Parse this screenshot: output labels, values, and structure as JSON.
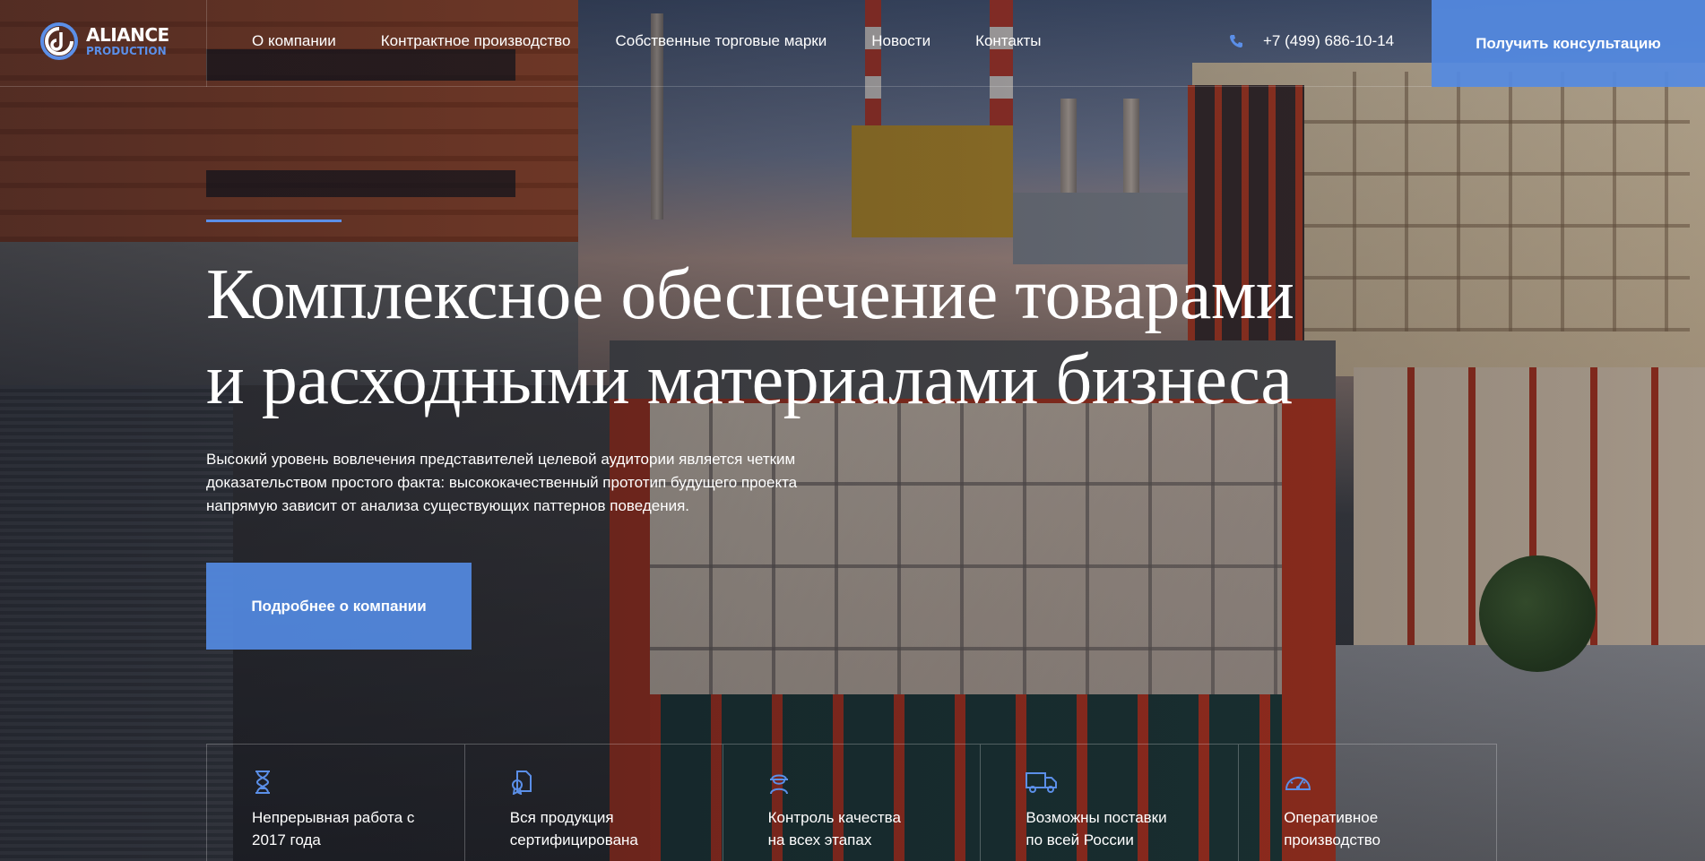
{
  "brand": {
    "name": "ALIANCE",
    "sub": "PRODUCTION",
    "accent_color": "#5b8fe8"
  },
  "nav": {
    "items": [
      {
        "label": "О компании"
      },
      {
        "label": "Контрактное производство"
      },
      {
        "label": "Собственные торговые марки"
      },
      {
        "label": "Новости"
      },
      {
        "label": "Контакты"
      }
    ]
  },
  "header": {
    "phone": "+7 (499) 686-10-14",
    "phone_icon": "phone-icon",
    "cta_label": "Получить консультацию"
  },
  "hero": {
    "title_lines": [
      "Комплексное обеспечение товарами",
      "и расходными материалами бизнеса"
    ],
    "description_lines": [
      "Высокий уровень вовлечения представителей целевой аудитории является четким",
      "доказательством простого факта: высококачественный прототип будущего проекта",
      "напрямую зависит от анализа существующих паттернов поведения."
    ],
    "button_label": "Подробнее о компании"
  },
  "features": [
    {
      "icon": "hourglass-icon",
      "lines": [
        "Непрерывная работа с",
        "2017 года"
      ]
    },
    {
      "icon": "certificate-icon",
      "lines": [
        "Вся продукция",
        "сертифицирована"
      ]
    },
    {
      "icon": "worker-helmet-icon",
      "lines": [
        "Контроль качества",
        "на всех этапах"
      ]
    },
    {
      "icon": "delivery-truck-icon",
      "lines": [
        "Возможны поставки",
        "по всей России"
      ]
    },
    {
      "icon": "speedometer-icon",
      "lines": [
        "Оперативное",
        "производство"
      ]
    }
  ]
}
